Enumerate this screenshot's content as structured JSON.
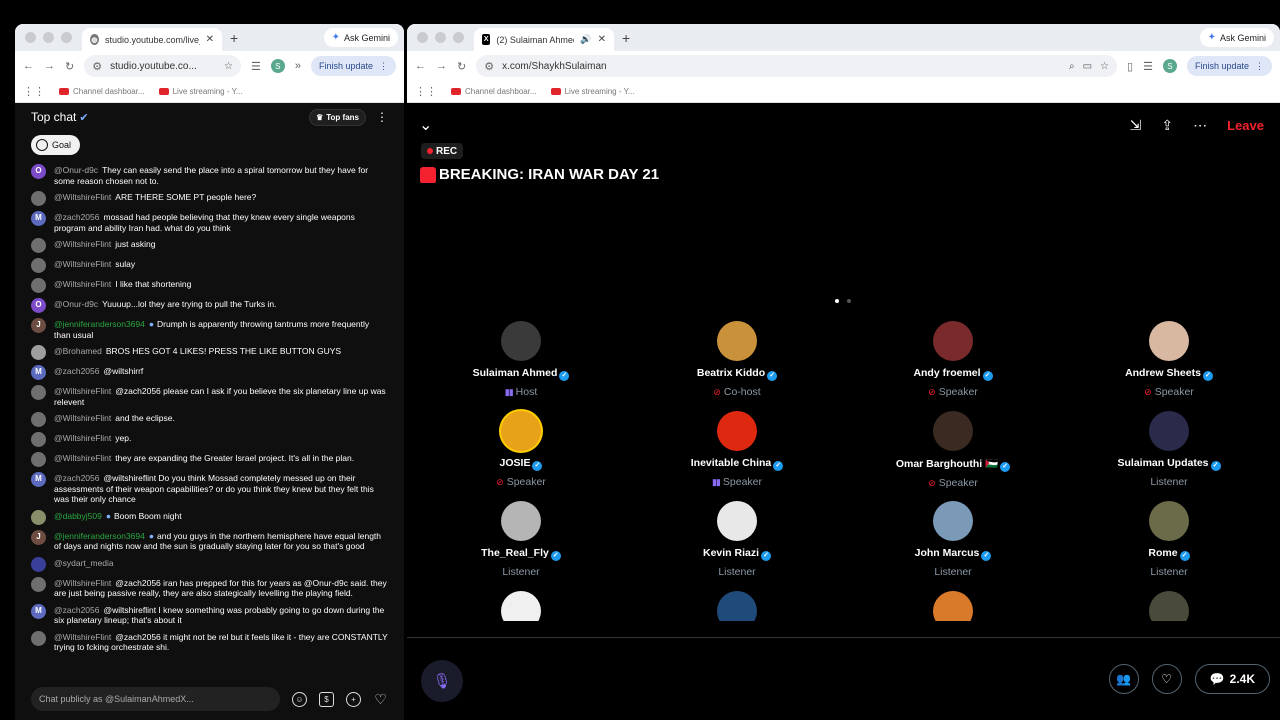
{
  "left_window": {
    "tab_title": "studio.youtube.com/live_chat",
    "address": "studio.youtube.co...",
    "ask_gemini": "Ask Gemini",
    "finish_update": "Finish update",
    "bookmarks": [
      "Channel dashboar...",
      "Live streaming - Y..."
    ],
    "chat": {
      "title": "Top chat",
      "top_fans": "Top fans",
      "goal": "Goal",
      "input_placeholder": "Chat publicly as @SulaimanAhmedX...",
      "messages": [
        {
          "author": "@Onur-d9c",
          "text": "They can easily send the place into a spiral tomorrow but they have for some reason chosen not to.",
          "avatar": "O",
          "color": "#7b4bc9",
          "member": false
        },
        {
          "author": "@WiltshireFlint",
          "text": "ARE THERE SOME PT people here?",
          "avatar": "",
          "color": "#6f6f6f",
          "member": false
        },
        {
          "author": "@zach2056",
          "text": "mossad had people believing that they knew every single weapons program and ability Iran had. what do you think",
          "avatar": "M",
          "color": "#5c6bc0",
          "member": false
        },
        {
          "author": "@WiltshireFlint",
          "text": "just asking",
          "avatar": "",
          "color": "#6f6f6f",
          "member": false
        },
        {
          "author": "@WiltshireFlint",
          "text": "sulay",
          "avatar": "",
          "color": "#6f6f6f",
          "member": false
        },
        {
          "author": "@WiltshireFlint",
          "text": "I like that shortening",
          "avatar": "",
          "color": "#6f6f6f",
          "member": false
        },
        {
          "author": "@Onur-d9c",
          "text": "Yuuuup...lol they are trying to pull the Turks in.",
          "avatar": "O",
          "color": "#7b4bc9",
          "member": false
        },
        {
          "author": "@jenniferanderson3694",
          "text": "Drumph is apparently throwing tantrums more frequently than usual",
          "avatar": "J",
          "color": "#6d4c41",
          "member": true
        },
        {
          "author": "@Brohamed",
          "text": "BROS HES GOT 4 LIKES! PRESS THE LIKE BUTTON GUYS",
          "avatar": "",
          "color": "#9e9e9e",
          "member": false
        },
        {
          "author": "@zach2056",
          "text": "@wiltshirrf",
          "avatar": "M",
          "color": "#5c6bc0",
          "member": false
        },
        {
          "author": "@WiltshireFlint",
          "text": "@zach2056 please can I ask if you believe the six planetary line up was relevent",
          "avatar": "",
          "color": "#6f6f6f",
          "member": false
        },
        {
          "author": "@WiltshireFlint",
          "text": "and the eclipse.",
          "avatar": "",
          "color": "#6f6f6f",
          "member": false
        },
        {
          "author": "@WiltshireFlint",
          "text": "yep.",
          "avatar": "",
          "color": "#6f6f6f",
          "member": false
        },
        {
          "author": "@WiltshireFlint",
          "text": "they are expanding the Greater Israel project. It's all in the plan.",
          "avatar": "",
          "color": "#6f6f6f",
          "member": false
        },
        {
          "author": "@zach2056",
          "text": "@wiltshireflint Do you think Mossad completely messed up on their assessments of their weapon capabilities? or do you think they knew but they felt this was their only chance",
          "avatar": "M",
          "color": "#5c6bc0",
          "member": false
        },
        {
          "author": "@dabbyj509",
          "text": "Boom Boom night",
          "avatar": "",
          "color": "#8a8f6a",
          "member": true
        },
        {
          "author": "@jenniferanderson3694",
          "text": "and you guys in the northern hemisphere have equal length of days and nights now and the sun is gradually staying later for you so that's good",
          "avatar": "J",
          "color": "#6d4c41",
          "member": true
        },
        {
          "author": "@sydart_media",
          "text": "",
          "avatar": "",
          "color": "#3a3f9a",
          "member": false
        },
        {
          "author": "@WiltshireFlint",
          "text": "@zach2056 iran has prepped for this for years as @Onur-d9c said. they are just being passive really, they are also stategically levelling the playing field.",
          "avatar": "",
          "color": "#6f6f6f",
          "member": false
        },
        {
          "author": "@zach2056",
          "text": "@wiltshireflint I knew something was probably going to go down during the six planetary lineup; that's about it",
          "avatar": "M",
          "color": "#5c6bc0",
          "member": false
        },
        {
          "author": "@WiltshireFlint",
          "text": "@zach2056 it might not be rel but it feels like it - they are CONSTANTLY trying to fcking orchestrate shi.",
          "avatar": "",
          "color": "#6f6f6f",
          "member": false
        }
      ]
    }
  },
  "right_window": {
    "tab_title": "(2) Sulaiman Ahmed (@S",
    "address": "x.com/ShaykhSulaiman",
    "ask_gemini": "Ask Gemini",
    "finish_update": "Finish update",
    "bookmarks": [
      "Channel dashboar...",
      "Live streaming - Y..."
    ],
    "space": {
      "rec": "REC",
      "title": "BREAKING: IRAN WAR DAY 21",
      "leave": "Leave",
      "listener_count": "2.4K",
      "participants": [
        {
          "name": "Sulaiman Ahmed",
          "role": "Host",
          "status": "speaking",
          "color": "#3a3a3a"
        },
        {
          "name": "Beatrix Kiddo",
          "role": "Co-host",
          "status": "muted",
          "color": "#c9923a"
        },
        {
          "name": "Andy froemel",
          "role": "Speaker",
          "status": "muted",
          "color": "#7a2a2a"
        },
        {
          "name": "Andrew Sheets",
          "role": "Speaker",
          "status": "muted",
          "color": "#d8b8a0"
        },
        {
          "name": "JOSIE",
          "role": "Speaker",
          "status": "muted",
          "color": "#e8a21a"
        },
        {
          "name": "Inevitable China",
          "role": "Speaker",
          "status": "speaking",
          "color": "#de2910"
        },
        {
          "name": "Omar Barghouthi 🇵🇸",
          "role": "Speaker",
          "status": "muted",
          "color": "#3b2a22"
        },
        {
          "name": "Sulaiman Updates",
          "role": "Listener",
          "status": "none",
          "color": "#2a2a4a"
        },
        {
          "name": "The_Real_Fly",
          "role": "Listener",
          "status": "none",
          "color": "#b5b5b5"
        },
        {
          "name": "Kevin Riazi",
          "role": "Listener",
          "status": "none",
          "color": "#e8e8e8"
        },
        {
          "name": "John Marcus",
          "role": "Listener",
          "status": "none",
          "color": "#7a9ab8"
        },
        {
          "name": "Rome",
          "role": "Listener",
          "status": "none",
          "color": "#6b6b4a"
        },
        {
          "name": "",
          "role": "",
          "status": "none",
          "color": "#f0f0f0"
        },
        {
          "name": "",
          "role": "",
          "status": "none",
          "color": "#1f4a7a"
        },
        {
          "name": "",
          "role": "",
          "status": "none",
          "color": "#d87a2a"
        },
        {
          "name": "",
          "role": "",
          "status": "none",
          "color": "#4a4a3a"
        }
      ]
    }
  }
}
